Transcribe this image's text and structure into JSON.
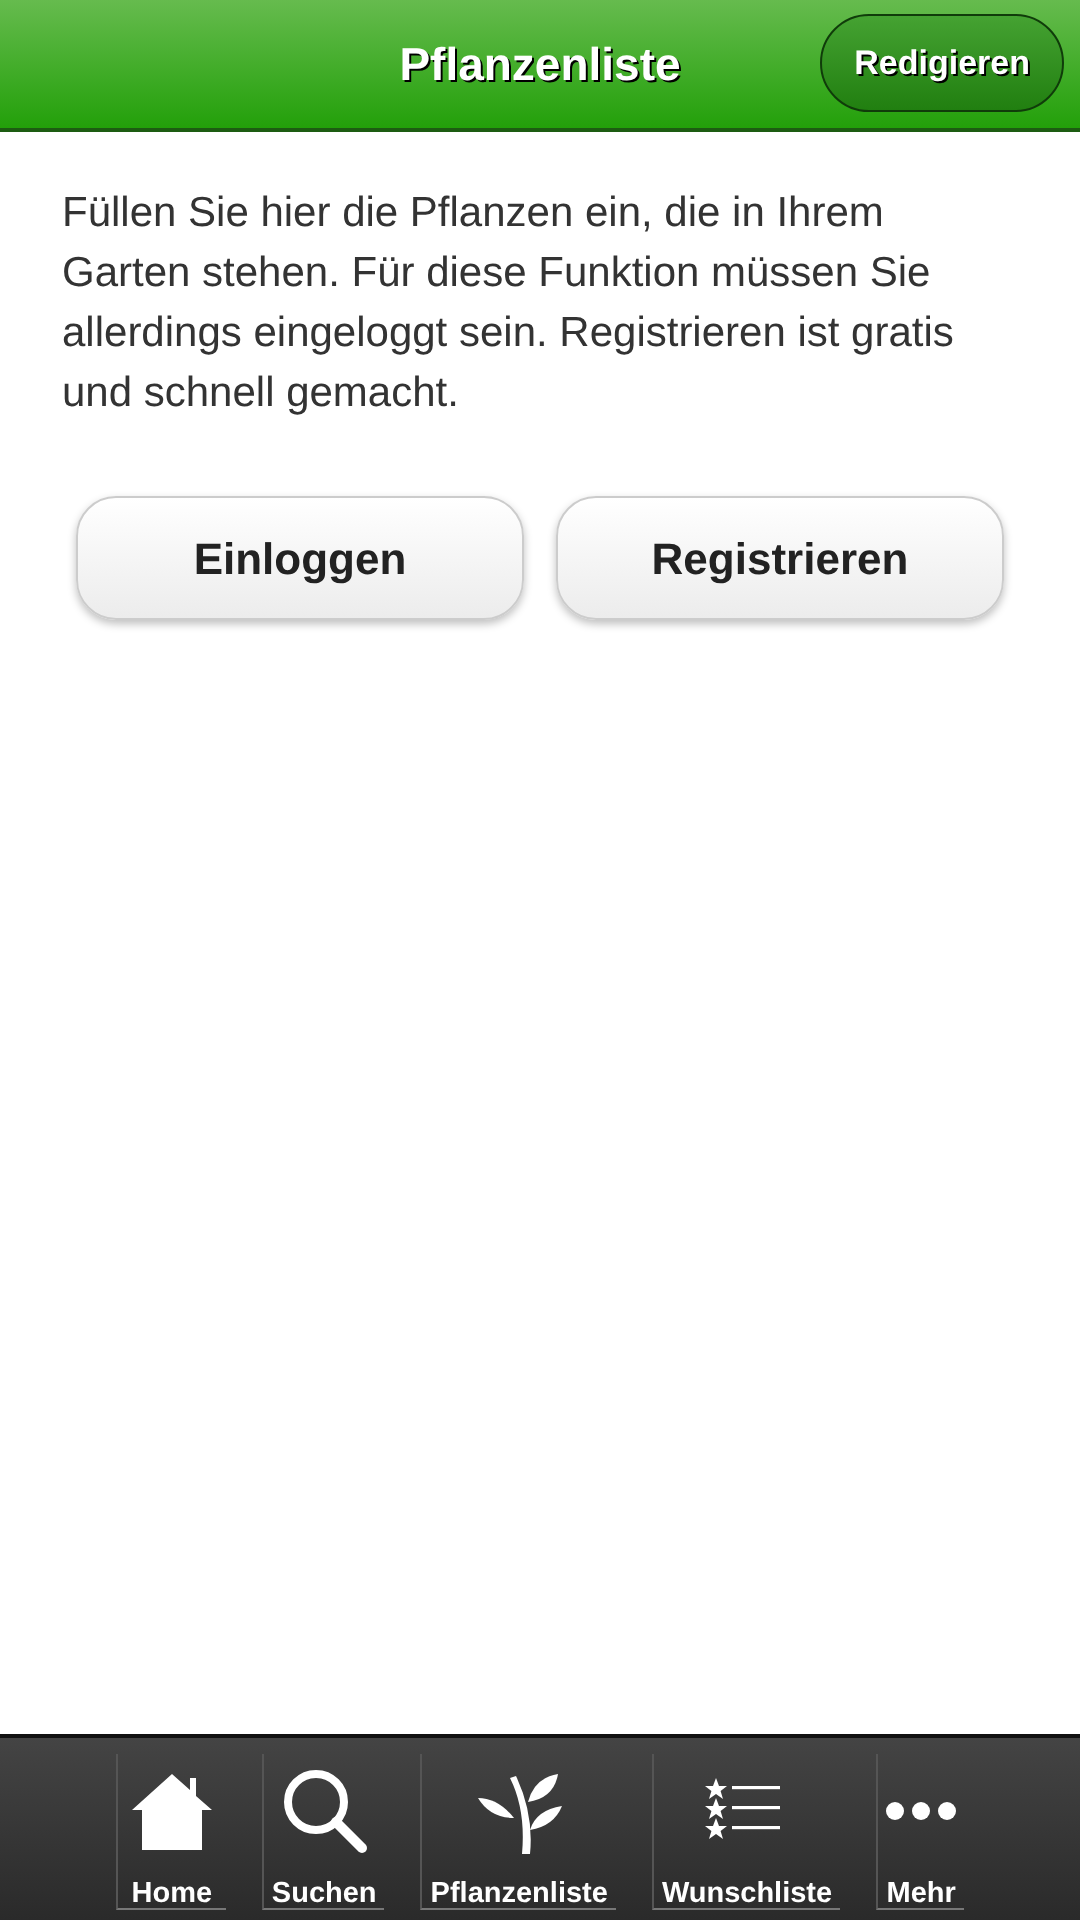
{
  "header": {
    "title": "Pflanzenliste",
    "edit_button": "Redigieren"
  },
  "intro": "Füllen Sie hier die Pflanzen ein, die in Ihrem Garten stehen. Für diese Funktion müssen Sie allerdings eingeloggt sein. Registrieren ist gratis und schnell gemacht.",
  "buttons": [
    "Einloggen",
    "Registrieren"
  ],
  "tab_bar": [
    {
      "kind": "home",
      "label": "Home"
    },
    {
      "kind": "search",
      "label": "Suchen"
    },
    {
      "kind": "plant",
      "label": "Pflanzenliste"
    },
    {
      "kind": "wishlist",
      "label": "Wunschliste"
    },
    {
      "kind": "more",
      "label": "Mehr"
    }
  ]
}
